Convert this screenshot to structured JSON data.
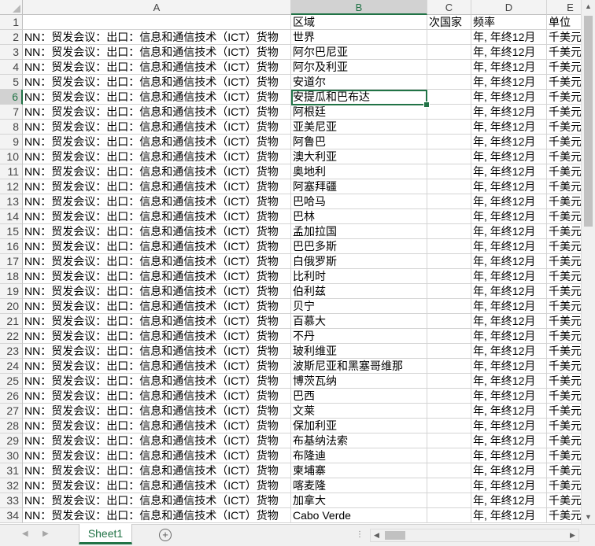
{
  "columns": [
    {
      "letter": "A"
    },
    {
      "letter": "B"
    },
    {
      "letter": "C"
    },
    {
      "letter": "D"
    },
    {
      "letter": "E"
    }
  ],
  "header_row": {
    "num": "1",
    "a": "",
    "b": "区域",
    "c": "次国家",
    "d": "频率",
    "e": "单位"
  },
  "rows": [
    {
      "num": "2",
      "a": "NN：贸发会议：出口：信息和通信技术（ICT）货物",
      "b": "世界",
      "d": "年, 年终12月",
      "e": "千美元"
    },
    {
      "num": "3",
      "a": "NN：贸发会议：出口：信息和通信技术（ICT）货物",
      "b": "阿尔巴尼亚",
      "d": "年, 年终12月",
      "e": "千美元"
    },
    {
      "num": "4",
      "a": "NN：贸发会议：出口：信息和通信技术（ICT）货物",
      "b": "阿尔及利亚",
      "d": "年, 年终12月",
      "e": "千美元"
    },
    {
      "num": "5",
      "a": "NN：贸发会议：出口：信息和通信技术（ICT）货物",
      "b": "安道尔",
      "d": "年, 年终12月",
      "e": "千美元"
    },
    {
      "num": "6",
      "a": "NN：贸发会议：出口：信息和通信技术（ICT）货物",
      "b": "安提瓜和巴布达",
      "d": "年, 年终12月",
      "e": "千美元"
    },
    {
      "num": "7",
      "a": "NN：贸发会议：出口：信息和通信技术（ICT）货物",
      "b": "阿根廷",
      "d": "年, 年终12月",
      "e": "千美元"
    },
    {
      "num": "8",
      "a": "NN：贸发会议：出口：信息和通信技术（ICT）货物",
      "b": "亚美尼亚",
      "d": "年, 年终12月",
      "e": "千美元"
    },
    {
      "num": "9",
      "a": "NN：贸发会议：出口：信息和通信技术（ICT）货物",
      "b": "阿鲁巴",
      "d": "年, 年终12月",
      "e": "千美元"
    },
    {
      "num": "10",
      "a": "NN：贸发会议：出口：信息和通信技术（ICT）货物",
      "b": "澳大利亚",
      "d": "年, 年终12月",
      "e": "千美元"
    },
    {
      "num": "11",
      "a": "NN：贸发会议：出口：信息和通信技术（ICT）货物",
      "b": "奥地利",
      "d": "年, 年终12月",
      "e": "千美元"
    },
    {
      "num": "12",
      "a": "NN：贸发会议：出口：信息和通信技术（ICT）货物",
      "b": "阿塞拜疆",
      "d": "年, 年终12月",
      "e": "千美元"
    },
    {
      "num": "13",
      "a": "NN：贸发会议：出口：信息和通信技术（ICT）货物",
      "b": "巴哈马",
      "d": "年, 年终12月",
      "e": "千美元"
    },
    {
      "num": "14",
      "a": "NN：贸发会议：出口：信息和通信技术（ICT）货物",
      "b": "巴林",
      "d": "年, 年终12月",
      "e": "千美元"
    },
    {
      "num": "15",
      "a": "NN：贸发会议：出口：信息和通信技术（ICT）货物",
      "b": "孟加拉国",
      "d": "年, 年终12月",
      "e": "千美元"
    },
    {
      "num": "16",
      "a": "NN：贸发会议：出口：信息和通信技术（ICT）货物",
      "b": "巴巴多斯",
      "d": "年, 年终12月",
      "e": "千美元"
    },
    {
      "num": "17",
      "a": "NN：贸发会议：出口：信息和通信技术（ICT）货物",
      "b": "白俄罗斯",
      "d": "年, 年终12月",
      "e": "千美元"
    },
    {
      "num": "18",
      "a": "NN：贸发会议：出口：信息和通信技术（ICT）货物",
      "b": "比利时",
      "d": "年, 年终12月",
      "e": "千美元"
    },
    {
      "num": "19",
      "a": "NN：贸发会议：出口：信息和通信技术（ICT）货物",
      "b": "伯利兹",
      "d": "年, 年终12月",
      "e": "千美元"
    },
    {
      "num": "20",
      "a": "NN：贸发会议：出口：信息和通信技术（ICT）货物",
      "b": "贝宁",
      "d": "年, 年终12月",
      "e": "千美元"
    },
    {
      "num": "21",
      "a": "NN：贸发会议：出口：信息和通信技术（ICT）货物",
      "b": "百慕大",
      "d": "年, 年终12月",
      "e": "千美元"
    },
    {
      "num": "22",
      "a": "NN：贸发会议：出口：信息和通信技术（ICT）货物",
      "b": "不丹",
      "d": "年, 年终12月",
      "e": "千美元"
    },
    {
      "num": "23",
      "a": "NN：贸发会议：出口：信息和通信技术（ICT）货物",
      "b": "玻利维亚",
      "d": "年, 年终12月",
      "e": "千美元"
    },
    {
      "num": "24",
      "a": "NN：贸发会议：出口：信息和通信技术（ICT）货物",
      "b": "波斯尼亚和黑塞哥维那",
      "d": "年, 年终12月",
      "e": "千美元"
    },
    {
      "num": "25",
      "a": "NN：贸发会议：出口：信息和通信技术（ICT）货物",
      "b": "博茨瓦纳",
      "d": "年, 年终12月",
      "e": "千美元"
    },
    {
      "num": "26",
      "a": "NN：贸发会议：出口：信息和通信技术（ICT）货物",
      "b": "巴西",
      "d": "年, 年终12月",
      "e": "千美元"
    },
    {
      "num": "27",
      "a": "NN：贸发会议：出口：信息和通信技术（ICT）货物",
      "b": "文莱",
      "d": "年, 年终12月",
      "e": "千美元"
    },
    {
      "num": "28",
      "a": "NN：贸发会议：出口：信息和通信技术（ICT）货物",
      "b": "保加利亚",
      "d": "年, 年终12月",
      "e": "千美元"
    },
    {
      "num": "29",
      "a": "NN：贸发会议：出口：信息和通信技术（ICT）货物",
      "b": "布基纳法索",
      "d": "年, 年终12月",
      "e": "千美元"
    },
    {
      "num": "30",
      "a": "NN：贸发会议：出口：信息和通信技术（ICT）货物",
      "b": "布隆迪",
      "d": "年, 年终12月",
      "e": "千美元"
    },
    {
      "num": "31",
      "a": "NN：贸发会议：出口：信息和通信技术（ICT）货物",
      "b": "柬埔寨",
      "d": "年, 年终12月",
      "e": "千美元"
    },
    {
      "num": "32",
      "a": "NN：贸发会议：出口：信息和通信技术（ICT）货物",
      "b": "喀麦隆",
      "d": "年, 年终12月",
      "e": "千美元"
    },
    {
      "num": "33",
      "a": "NN：贸发会议：出口：信息和通信技术（ICT）货物",
      "b": "加拿大",
      "d": "年, 年终12月",
      "e": "千美元"
    },
    {
      "num": "34",
      "a": "NN：贸发会议：出口：信息和通信技术（ICT）货物",
      "b": "Cabo Verde",
      "d": "年, 年终12月",
      "e": "千美元"
    }
  ],
  "selected_cell": {
    "row": "6",
    "col": "B"
  },
  "sheet_tabs": [
    {
      "label": "Sheet1",
      "active": true
    }
  ],
  "icons": {
    "add_sheet": "plus-circle-icon",
    "scroll_up": "triangle-up-icon",
    "scroll_down": "triangle-down-icon",
    "scroll_left": "triangle-left-icon",
    "scroll_right": "triangle-right-icon"
  },
  "colors": {
    "accent": "#217346",
    "header_bg": "#f3f3f3",
    "gridline": "#d4d4d4"
  }
}
